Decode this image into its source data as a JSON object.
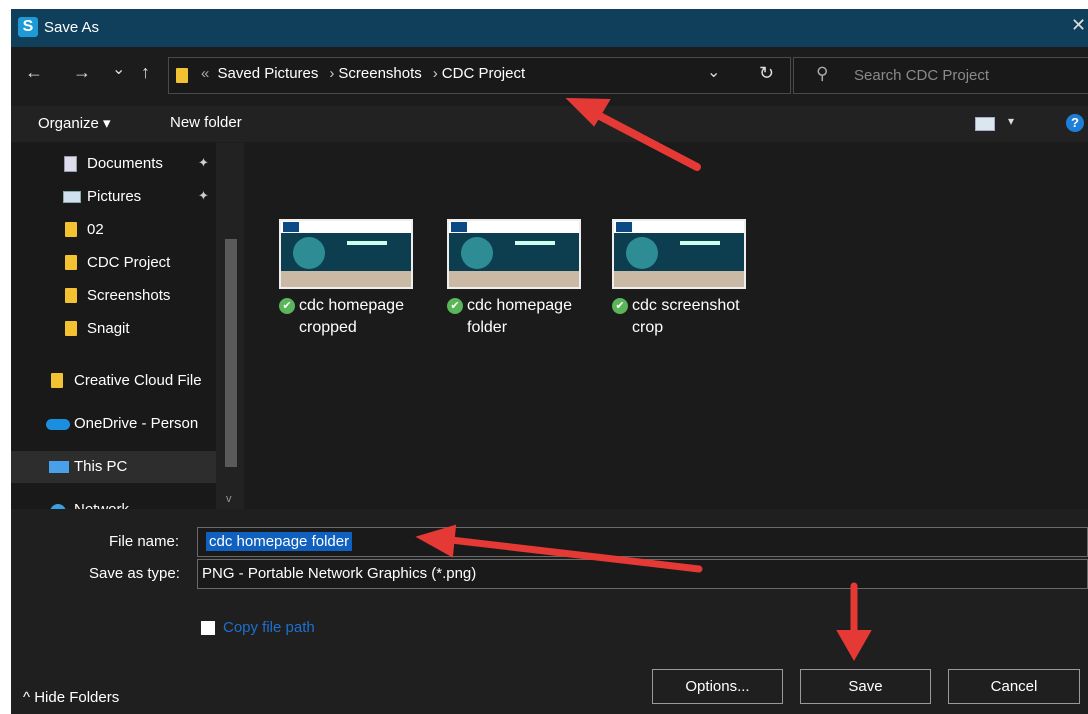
{
  "window": {
    "title": "Save As",
    "app_icon": "S",
    "close": "✕"
  },
  "nav": {
    "back": "←",
    "forward": "→",
    "recent": "⌄",
    "up": "↑"
  },
  "address": {
    "overflow": "«",
    "crumbs": [
      "Saved Pictures",
      "Screenshots",
      "CDC Project"
    ],
    "separator": "›",
    "dropdown": "⌄",
    "refresh": "↻"
  },
  "search": {
    "placeholder": "Search CDC Project",
    "icon": "⚲"
  },
  "toolbar": {
    "organize": "Organize ▾",
    "new_folder": "New folder",
    "view_arrow": "▾",
    "help": "?"
  },
  "navpane": {
    "items": [
      {
        "label": "Documents",
        "icon": "documents-icon",
        "pinned": true
      },
      {
        "label": "Pictures",
        "icon": "pictures-icon",
        "pinned": true
      },
      {
        "label": "02",
        "icon": "folder-icon"
      },
      {
        "label": "CDC Project",
        "icon": "folder-icon"
      },
      {
        "label": "Screenshots",
        "icon": "folder-icon"
      },
      {
        "label": "Snagit",
        "icon": "folder-icon"
      },
      {
        "label": "Creative Cloud File",
        "icon": "creative-cloud-folder-icon"
      },
      {
        "label": "OneDrive - Person",
        "icon": "onedrive-icon"
      },
      {
        "label": "This PC",
        "icon": "pc-icon",
        "selected": true
      },
      {
        "label": "Network",
        "icon": "network-icon"
      }
    ],
    "pin": "✦"
  },
  "files": [
    {
      "line1": "cdc homepage",
      "line2": "cropped"
    },
    {
      "line1": "cdc homepage",
      "line2": "folder"
    },
    {
      "line1": "cdc screenshot",
      "line2": "crop"
    }
  ],
  "form": {
    "file_name_label": "File name:",
    "file_name_value": "cdc homepage folder",
    "save_type_label": "Save as type:",
    "save_type_value": "PNG - Portable Network Graphics (*.png)",
    "copy_path_label": "Copy file path",
    "dropdown": "⌄"
  },
  "buttons": {
    "hide_folders": "^ Hide Folders",
    "options": "Options...",
    "save": "Save",
    "cancel": "Cancel"
  },
  "colors": {
    "accent": "#1060c0",
    "arrow": "#e53935",
    "titlebar": "#103f5c"
  }
}
